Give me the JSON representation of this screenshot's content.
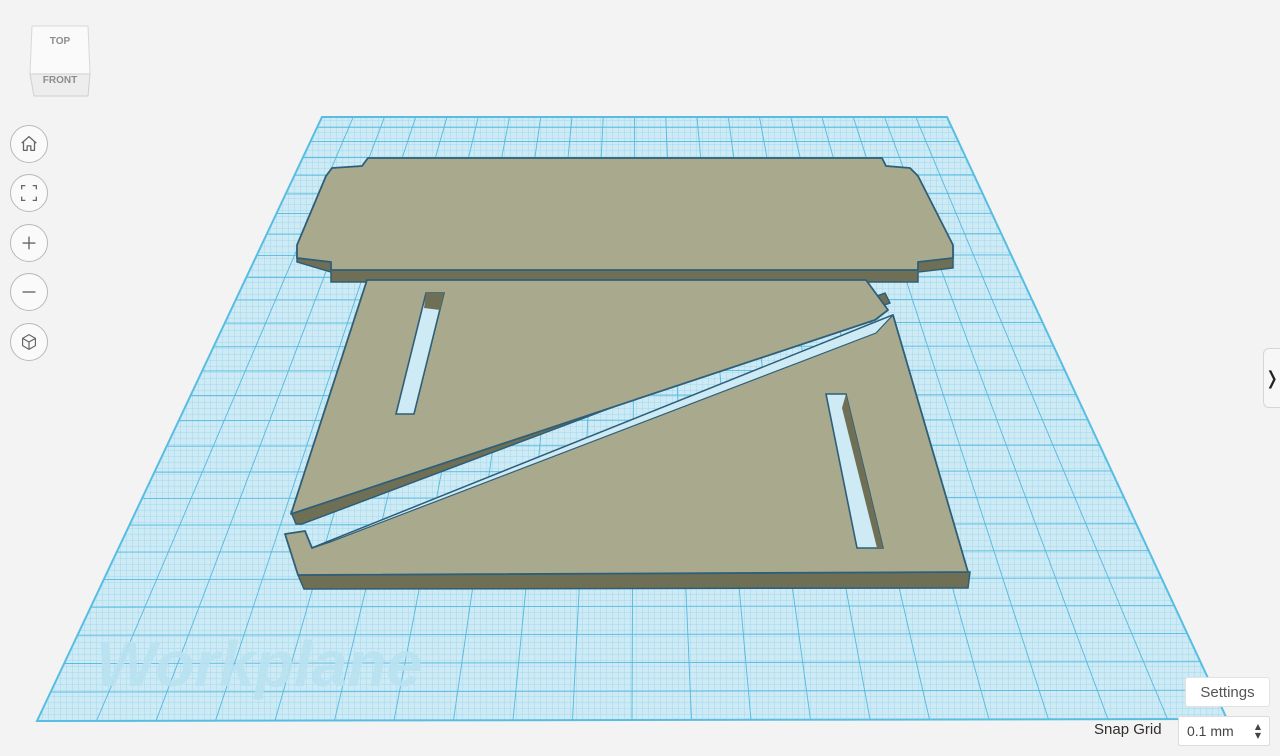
{
  "viewcube": {
    "top_label": "TOP",
    "front_label": "FRONT"
  },
  "workplane": {
    "label": "Workplane",
    "grid_color": "#5ec3e6",
    "plane_color": "#c7e8f4"
  },
  "shape_color": "#a9a98d",
  "shape_outline": "#2e5f78",
  "nav_icons": [
    "home-icon",
    "fit-view-icon",
    "zoom-in-icon",
    "zoom-out-icon",
    "orthographic-icon"
  ],
  "side_panel": {
    "toggle_glyph": "❭"
  },
  "settings": {
    "label": "Settings"
  },
  "snap_grid": {
    "label": "Snap Grid",
    "value": "0.1 mm"
  }
}
